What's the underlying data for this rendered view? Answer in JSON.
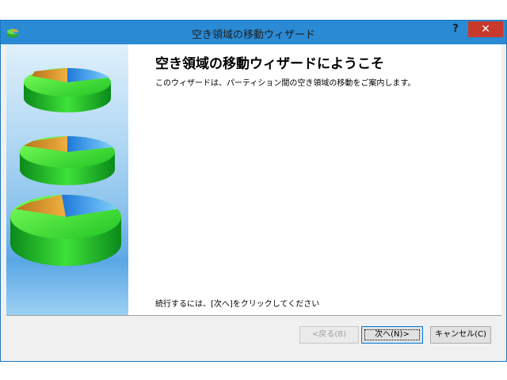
{
  "window": {
    "title": "空き領域の移動ウィザード",
    "help_label": "?",
    "close_label": "✕",
    "titlebar_color": "#2a8ad4",
    "close_color": "#c7392b"
  },
  "content": {
    "heading": "空き領域の移動ウィザードにようこそ",
    "description": "このウィザードは、パーティション間の空き領域の移動をご案内します。",
    "hint": "続行するには、[次へ]をクリックしてください"
  },
  "buttons": {
    "back": "<戻る(B)",
    "next": "次へ(N)>",
    "cancel": "キャンセル(C)"
  },
  "icons": {
    "app": "disk-wizard-icon",
    "illustration": "disk-pie-chart-icon"
  }
}
